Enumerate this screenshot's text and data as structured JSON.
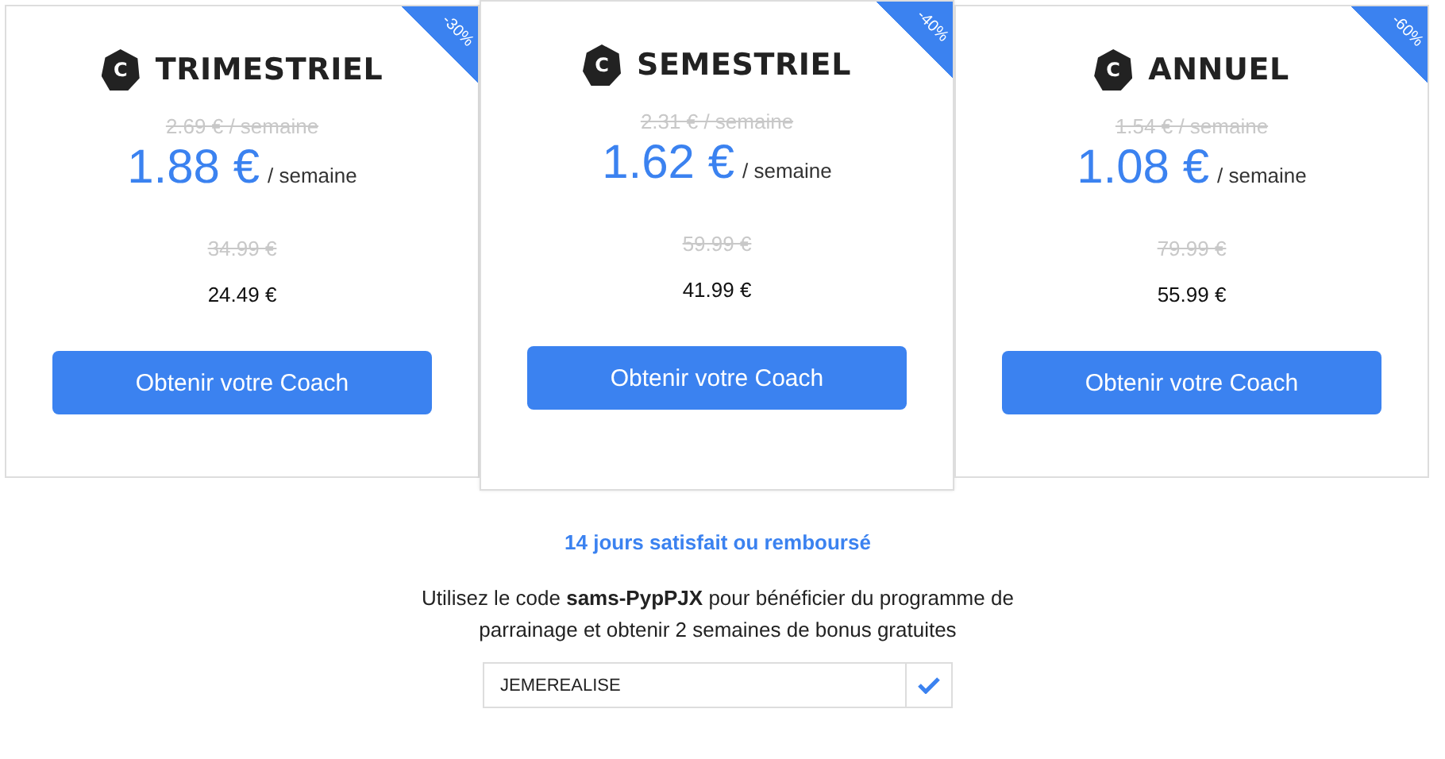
{
  "plans": [
    {
      "badge": "-30%",
      "logo": "C",
      "name": "TRIMESTRIEL",
      "old_weekly": "2.69 € / semaine",
      "price": "1.88 €",
      "unit": "/ semaine",
      "old_total": "34.99 €",
      "total": "24.49 €",
      "button": "Obtenir votre Coach",
      "selected": false
    },
    {
      "badge": "-40%",
      "logo": "C",
      "name": "SEMESTRIEL",
      "old_weekly": "2.31 € / semaine",
      "price": "1.62 €",
      "unit": "/ semaine",
      "old_total": "59.99 €",
      "total": "41.99 €",
      "button": "Obtenir votre Coach",
      "selected": true
    },
    {
      "badge": "-60%",
      "logo": "C",
      "name": "ANNUEL",
      "old_weekly": "1.54 € / semaine",
      "price": "1.08 €",
      "unit": "/ semaine",
      "old_total": "79.99 €",
      "total": "55.99 €",
      "button": "Obtenir votre Coach",
      "selected": false
    }
  ],
  "guarantee": "14 jours satisfait ou remboursé",
  "referral": "Utilisez le code **sams-PypPJX** pour bénéficier du programme de parrainage et obtenir 2 semaines de bonus gratuites",
  "coupon": {
    "value": "JEMEREALISE"
  }
}
